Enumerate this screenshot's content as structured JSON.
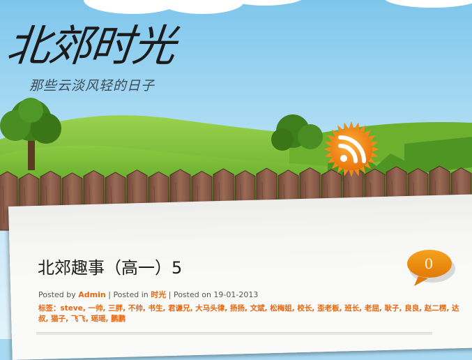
{
  "site": {
    "title": "北郊时光",
    "tagline": "那些云淡风轻的日子"
  },
  "rss": {
    "icon": "rss-icon"
  },
  "post": {
    "title": "北郊趣事（高一）5",
    "comment_count": "0",
    "meta": {
      "posted_by_label": "Posted by",
      "author": "Admin",
      "separator": "|",
      "posted_in_label": "Posted in",
      "category": "时光",
      "posted_on_label": "Posted on",
      "date": "19-01-2013"
    },
    "tags_label": "标签：",
    "tags": [
      "steve",
      "一帅",
      "三胖",
      "不帅",
      "书生",
      "君谦兄",
      "大马头律",
      "扬扬",
      "文斌",
      "松梅姐",
      "校长",
      "歪老板",
      "班长",
      "老屈",
      "耿子",
      "良良",
      "赵二楞",
      "达叔",
      "猫子",
      "飞飞",
      "瑶瑶",
      "鹏鹏"
    ]
  },
  "colors": {
    "accent": "#e8650c",
    "sky": "#a9d9f2",
    "grass": "#7bbf3a",
    "fence": "#8a5a45"
  }
}
